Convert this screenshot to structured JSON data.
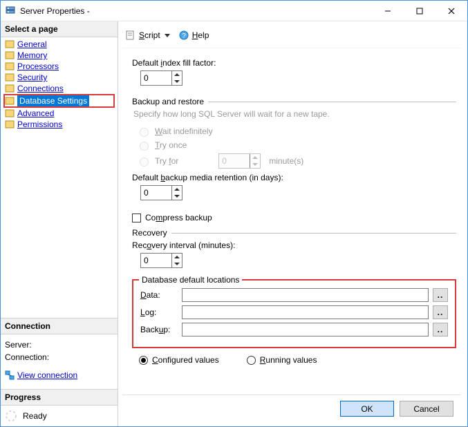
{
  "window": {
    "title": "Server Properties -"
  },
  "titlebar_buttons": {
    "min": "—",
    "max": "☐",
    "close": "✕"
  },
  "sidebar": {
    "select_page_header": "Select a page",
    "pages": [
      {
        "label": "General"
      },
      {
        "label": "Memory"
      },
      {
        "label": "Processors"
      },
      {
        "label": "Security"
      },
      {
        "label": "Connections"
      },
      {
        "label": "Database Settings",
        "selected": true
      },
      {
        "label": "Advanced"
      },
      {
        "label": "Permissions"
      }
    ],
    "connection_header": "Connection",
    "server_label": "Server:",
    "server_value": "",
    "connection_label": "Connection:",
    "connection_value": "",
    "view_connection": "View connection ",
    "progress_header": "Progress",
    "progress_status": "Ready"
  },
  "toolbar": {
    "script": "Script",
    "help": "Help"
  },
  "main": {
    "fill_factor_label": "Default index fill factor:",
    "fill_factor_value": "0",
    "backup_restore_header": "Backup and restore",
    "backup_restore_helper": "Specify how long SQL Server will wait for a new tape.",
    "wait_indef": "Wait indefinitely",
    "try_once": "Try once",
    "try_for": "Try for",
    "try_for_value": "0",
    "try_for_unit": "minute(s)",
    "retention_label": "Default backup media retention (in days):",
    "retention_value": "0",
    "compress_label": "Compress backup",
    "recovery_header": "Recovery",
    "recovery_interval_label": "Recovery interval (minutes):",
    "recovery_interval_value": "0",
    "locations_header": "Database default locations",
    "data_label": "Data:",
    "data_value": "",
    "log_label": "Log:",
    "log_value": "",
    "backup_label": "Backup:",
    "backup_value": "",
    "browse_label": "..",
    "configured_values": "Configured values",
    "running_values": "Running values"
  },
  "buttons": {
    "ok": "OK",
    "cancel": "Cancel"
  }
}
